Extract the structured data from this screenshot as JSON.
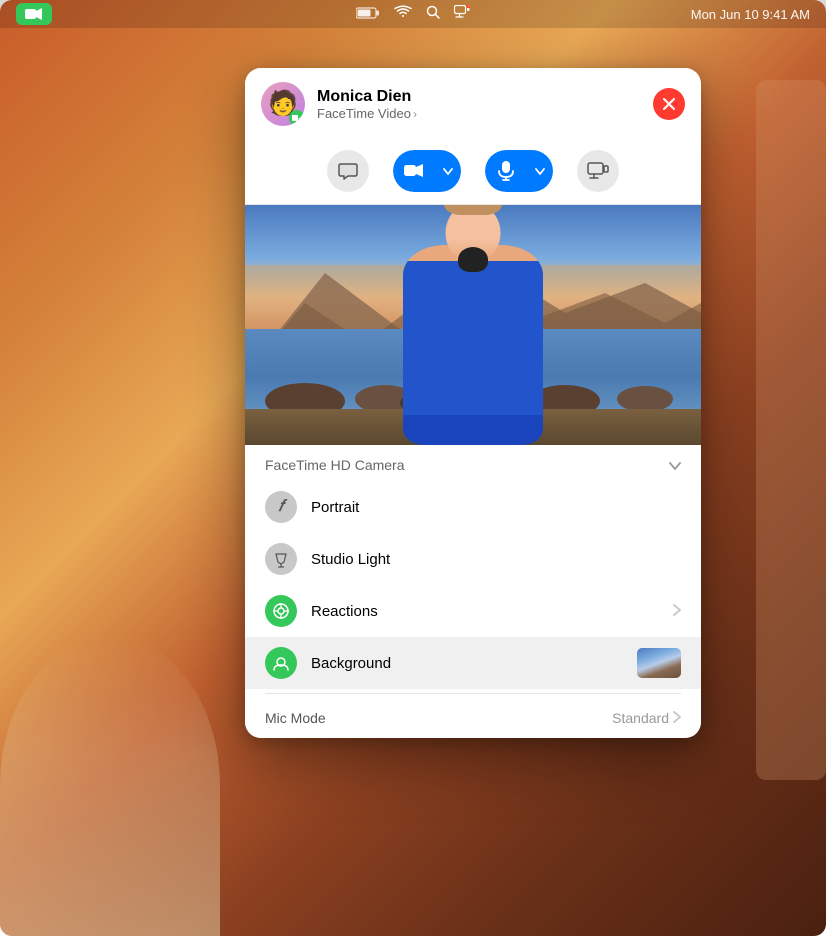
{
  "desktop": {
    "bg_description": "macOS orange-warm desktop background"
  },
  "menubar": {
    "facetime_icon": "🎥",
    "battery": "▭",
    "wifi": "wifi",
    "search": "🔍",
    "screen": "⊞",
    "date_time": "Mon Jun 10  9:41 AM"
  },
  "facetime_panel": {
    "contact_name": "Monica Dien",
    "contact_subtitle": "FaceTime Video",
    "subtitle_chevron": "›",
    "close_label": "×",
    "controls": {
      "chat_icon": "💬",
      "video_icon": "📷",
      "video_chevron": "∨",
      "mic_icon": "🎤",
      "mic_chevron": "∨",
      "screen_share_icon": "⊡"
    },
    "camera_section": {
      "label": "FaceTime HD Camera",
      "chevron": "∨"
    },
    "menu_items": [
      {
        "id": "portrait",
        "icon": "𝑓",
        "icon_style": "gray",
        "label": "Portrait",
        "has_chevron": false,
        "has_thumbnail": false,
        "selected": false
      },
      {
        "id": "studio-light",
        "icon": "⬡",
        "icon_style": "gray",
        "label": "Studio Light",
        "has_chevron": false,
        "has_thumbnail": false,
        "selected": false
      },
      {
        "id": "reactions",
        "icon": "⊕",
        "icon_style": "green",
        "label": "Reactions",
        "has_chevron": true,
        "has_thumbnail": false,
        "selected": false
      },
      {
        "id": "background",
        "icon": "👤",
        "icon_style": "green",
        "label": "Background",
        "has_chevron": false,
        "has_thumbnail": true,
        "selected": true
      }
    ],
    "mic_mode": {
      "label": "Mic Mode",
      "value": "Standard",
      "chevron": "›"
    }
  }
}
